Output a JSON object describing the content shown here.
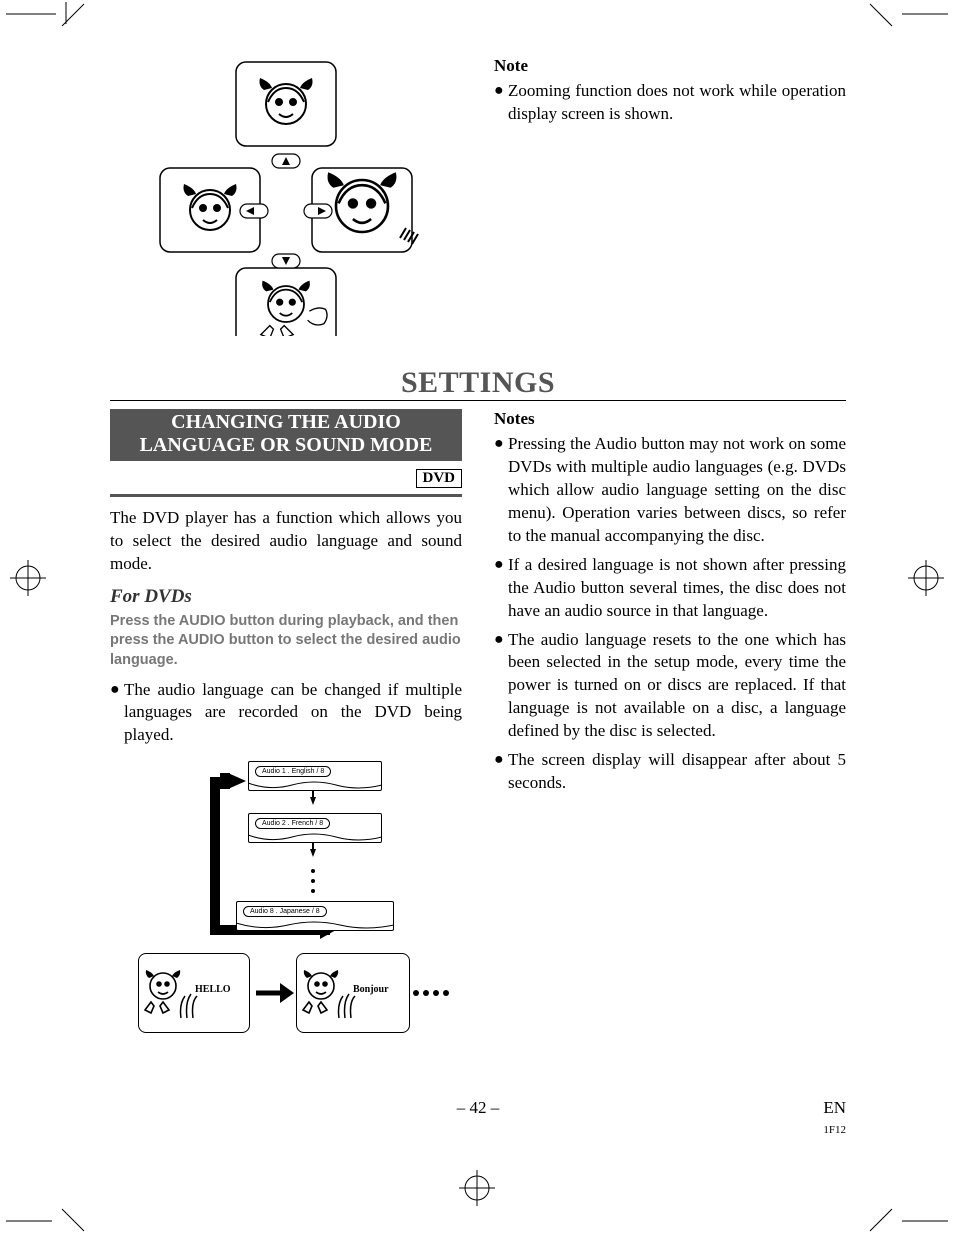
{
  "top": {
    "note_head": "Note",
    "note_bullet": "Zooming function does not work while operation display screen is shown."
  },
  "settings_title": "SETTINGS",
  "section": {
    "heading_line1": "CHANGING THE AUDIO",
    "heading_line2": "LANGUAGE OR SOUND MODE",
    "badge": "DVD",
    "intro": "The DVD player has a function which allows you to select the desired audio language and sound mode.",
    "sub": "For DVDs",
    "instruction": "Press the AUDIO button during playback, and then press the AUDIO button to select the desired audio language.",
    "bullet": "The audio language can be changed if multiple languages are recorded on the DVD being played."
  },
  "diagram": {
    "chip1": "Audio 1 . English / 8",
    "chip2": "Audio 2 . French / 8",
    "chip3": "Audio 8 . Japanese / 8",
    "hello": "HELLO",
    "bonjour": "Bonjour"
  },
  "right_notes": {
    "head": "Notes",
    "b1": "Pressing the Audio button may not work on some DVDs with multiple audio languages (e.g. DVDs which allow audio language setting on the disc menu). Operation varies between discs, so refer to the manual accompanying the disc.",
    "b2": "If a desired language is not shown after pressing the Audio button several times, the disc does not have an audio source in that language.",
    "b3": "The audio language resets to the one which has been selected in the setup mode, every time the power is turned on or discs are replaced. If that language is not available on a disc, a language defined by the disc is selected.",
    "b4": "The screen display will disappear after about 5 seconds."
  },
  "footer": {
    "page": "– 42 –",
    "lang": "EN",
    "code": "1F12"
  }
}
